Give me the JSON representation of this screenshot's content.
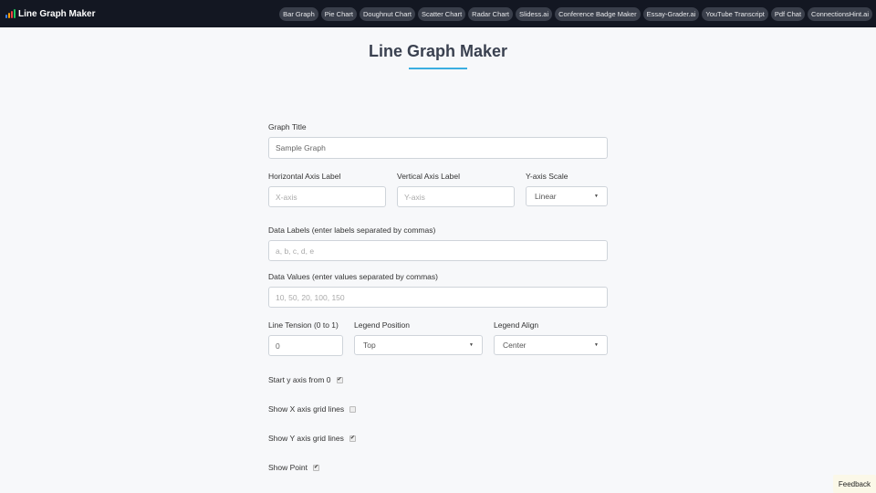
{
  "navbar": {
    "brand": "Line Graph Maker",
    "brand_icon": "bar-chart-icon",
    "links": [
      "Bar Graph",
      "Pie Chart",
      "Doughnut Chart",
      "Scatter Chart",
      "Radar Chart",
      "Slidess.ai",
      "Conference Badge Maker",
      "Essay-Grader.ai",
      "YouTube Transcript",
      "Pdf Chat",
      "ConnectionsHint.ai"
    ]
  },
  "page": {
    "title": "Line Graph Maker",
    "accent_color": "#3aaee0"
  },
  "form": {
    "graph_title": {
      "label": "Graph Title",
      "value": "Sample Graph"
    },
    "x_label": {
      "label": "Horizontal Axis Label",
      "placeholder": "X-axis"
    },
    "y_label": {
      "label": "Vertical Axis Label",
      "placeholder": "Y-axis"
    },
    "y_scale": {
      "label": "Y-axis Scale",
      "value": "Linear"
    },
    "data_labels": {
      "label": "Data Labels (enter labels separated by commas)",
      "placeholder": "a, b, c, d, e"
    },
    "data_values": {
      "label": "Data Values (enter values separated by commas)",
      "placeholder": "10, 50, 20, 100, 150"
    },
    "line_tension": {
      "label": "Line Tension (0 to 1)",
      "value": "0"
    },
    "legend_position": {
      "label": "Legend Position",
      "value": "Top"
    },
    "legend_align": {
      "label": "Legend Align",
      "value": "Center"
    },
    "start_y_zero": {
      "label": "Start y axis from 0",
      "checked": true,
      "mark": "✔"
    },
    "show_x_grid": {
      "label": "Show X axis grid lines",
      "checked": false,
      "mark": ""
    },
    "show_y_grid": {
      "label": "Show Y axis grid lines",
      "checked": true,
      "mark": "✔"
    },
    "show_point": {
      "label": "Show Point",
      "checked": true,
      "mark": "✔"
    }
  },
  "feedback": {
    "label": "Feedback"
  },
  "caret": "▼"
}
